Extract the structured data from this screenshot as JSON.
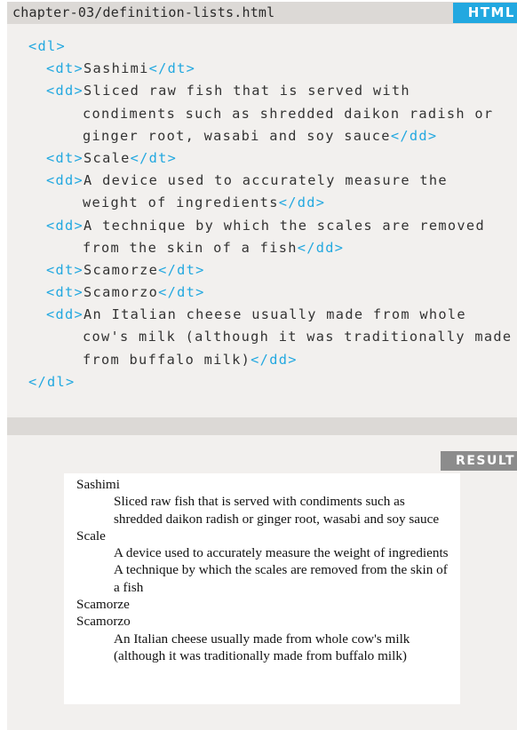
{
  "code_panel": {
    "filename": "chapter-03/definition-lists.html",
    "badge": "HTML",
    "lines": [
      {
        "indent": 0,
        "parts": [
          {
            "t": "tag",
            "v": "<dl>"
          }
        ]
      },
      {
        "indent": 1,
        "parts": [
          {
            "t": "tag",
            "v": "<dt>"
          },
          {
            "t": "text",
            "v": "Sashimi"
          },
          {
            "t": "tag",
            "v": "</dt>"
          }
        ]
      },
      {
        "indent": 1,
        "parts": [
          {
            "t": "tag",
            "v": "<dd>"
          },
          {
            "t": "text",
            "v": "Sliced raw fish that is served with"
          }
        ]
      },
      {
        "indent": 2,
        "parts": [
          {
            "t": "text",
            "v": "condiments such as shredded daikon radish or"
          }
        ]
      },
      {
        "indent": 2,
        "parts": [
          {
            "t": "text",
            "v": "ginger root, wasabi and soy sauce"
          },
          {
            "t": "tag",
            "v": "</dd>"
          }
        ]
      },
      {
        "indent": 1,
        "parts": [
          {
            "t": "tag",
            "v": "<dt>"
          },
          {
            "t": "text",
            "v": "Scale"
          },
          {
            "t": "tag",
            "v": "</dt>"
          }
        ]
      },
      {
        "indent": 1,
        "parts": [
          {
            "t": "tag",
            "v": "<dd>"
          },
          {
            "t": "text",
            "v": "A device used to accurately measure the"
          }
        ]
      },
      {
        "indent": 2,
        "parts": [
          {
            "t": "text",
            "v": "weight of ingredients"
          },
          {
            "t": "tag",
            "v": "</dd>"
          }
        ]
      },
      {
        "indent": 1,
        "parts": [
          {
            "t": "tag",
            "v": "<dd>"
          },
          {
            "t": "text",
            "v": "A technique by which the scales are removed"
          }
        ]
      },
      {
        "indent": 2,
        "parts": [
          {
            "t": "text",
            "v": "from the skin of a fish"
          },
          {
            "t": "tag",
            "v": "</dd>"
          }
        ]
      },
      {
        "indent": 1,
        "parts": [
          {
            "t": "tag",
            "v": "<dt>"
          },
          {
            "t": "text",
            "v": "Scamorze"
          },
          {
            "t": "tag",
            "v": "</dt>"
          }
        ]
      },
      {
        "indent": 1,
        "parts": [
          {
            "t": "tag",
            "v": "<dt>"
          },
          {
            "t": "text",
            "v": "Scamorzo"
          },
          {
            "t": "tag",
            "v": "</dt>"
          }
        ]
      },
      {
        "indent": 1,
        "parts": [
          {
            "t": "tag",
            "v": "<dd>"
          },
          {
            "t": "text",
            "v": "An Italian cheese usually made from whole"
          }
        ]
      },
      {
        "indent": 2,
        "parts": [
          {
            "t": "text",
            "v": "cow's milk (although it was traditionally made"
          }
        ]
      },
      {
        "indent": 2,
        "parts": [
          {
            "t": "text",
            "v": "from buffalo milk)"
          },
          {
            "t": "tag",
            "v": "</dd>"
          }
        ]
      },
      {
        "indent": 0,
        "parts": [
          {
            "t": "tag",
            "v": "</dl>"
          }
        ]
      }
    ]
  },
  "result_panel": {
    "badge": "RESULT",
    "list": [
      {
        "kind": "dt",
        "text": "Sashimi"
      },
      {
        "kind": "dd",
        "text": "Sliced raw fish that is served with condiments such as shredded daikon radish or ginger root, wasabi and soy sauce"
      },
      {
        "kind": "dt",
        "text": "Scale"
      },
      {
        "kind": "dd",
        "text": "A device used to accurately measure the weight of ingredients"
      },
      {
        "kind": "dd",
        "text": "A technique by which the scales are removed from the skin of a fish"
      },
      {
        "kind": "dt",
        "text": "Scamorze"
      },
      {
        "kind": "dt",
        "text": "Scamorzo"
      },
      {
        "kind": "dd",
        "text": "An Italian cheese usually made from whole cow's milk (although it was traditionally made from buffalo milk)"
      }
    ]
  },
  "colors": {
    "tag": "#22a8e0",
    "text": "#333333",
    "html_badge": "#22a8e0",
    "result_badge": "#8c8c8c",
    "panel_bg": "#f2f0ee",
    "header_bg": "#dcd9d6"
  }
}
